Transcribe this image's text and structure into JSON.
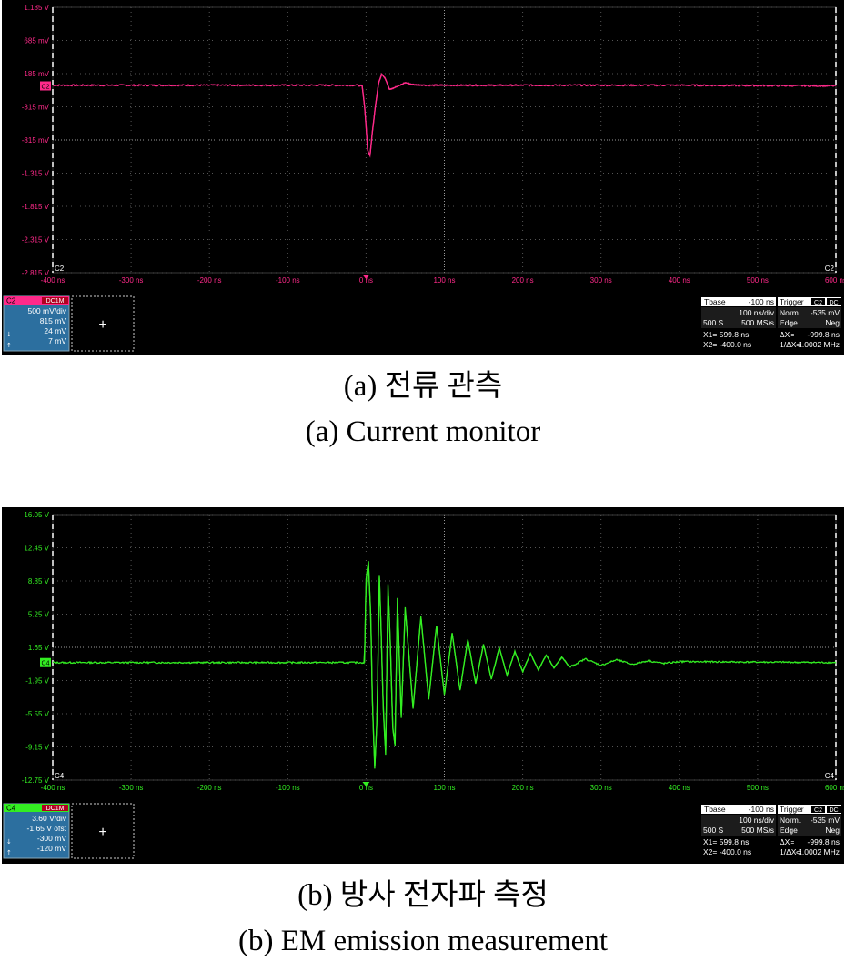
{
  "chart_data": [
    {
      "type": "line",
      "channel": "C2",
      "color": "#ff2a8a",
      "x_unit": "ns",
      "xlim": [
        -400,
        600
      ],
      "ylim": [
        -2.815,
        1.185
      ],
      "y_ticks": [
        "1.185 V",
        "685 mV",
        "185 mV",
        "-315 mV",
        "-815 mV",
        "-1.315 V",
        "-1.815 V",
        "-2.315 V",
        "-2.815 V"
      ],
      "x_ticks": [
        "-400 ns",
        "-300 ns",
        "-200 ns",
        "-100 ns",
        "0 ns",
        "100 ns",
        "200 ns",
        "300 ns",
        "400 ns",
        "500 ns",
        "600 ns"
      ],
      "ch_label": "C2",
      "grid": true,
      "series": [
        {
          "x": [
            -400,
            -200,
            -10,
            -5,
            -2,
            0,
            2,
            5,
            8,
            12,
            16,
            20,
            25,
            30,
            40,
            50,
            60,
            80,
            100,
            200,
            400,
            600
          ],
          "y": [
            0.01,
            0.01,
            0.01,
            0.0,
            -0.3,
            -0.6,
            -0.97,
            -1.05,
            -0.7,
            -0.3,
            0.05,
            0.18,
            0.1,
            -0.05,
            -0.01,
            0.05,
            0.02,
            0.01,
            0.01,
            0.01,
            0.01,
            0.0
          ]
        }
      ],
      "ch_panel": {
        "name": "C2",
        "coupling": "DC1M",
        "lines": [
          "500 mV/div",
          "815 mV",
          "24 mV",
          "7 mV"
        ]
      },
      "cursor_add": "+",
      "timebase": {
        "tbase_label": "Tbase",
        "tbase_value": "-100 ns",
        "trigger_label": "Trigger",
        "trigger_ch": "C2",
        "trigger_coupling": "DC",
        "div": "100 ns/div",
        "norm_label": "Norm.",
        "norm_value": "-535 mV",
        "samples": "500 S",
        "rate": "500 MS/s",
        "edge_label": "Edge",
        "edge_value": "Neg",
        "x1": "X1=   599.8 ns",
        "dx": "ΔX=",
        "dx_val": "-999.8 ns",
        "x2": "X2=  -400.0 ns",
        "inv_dx": "1/ΔX=",
        "inv_dx_val": "-1.0002 MHz"
      },
      "caption_ko": "(a)  전류  관측",
      "caption_en": "(a)  Current  monitor"
    },
    {
      "type": "line",
      "channel": "C4",
      "color": "#33ee22",
      "x_unit": "ns",
      "xlim": [
        -400,
        600
      ],
      "ylim": [
        -12.75,
        16.05
      ],
      "y_ticks": [
        "16.05 V",
        "12.45 V",
        "8.85 V",
        "5.25 V",
        "1.65 V",
        "-1.95 V",
        "-5.55 V",
        "-9.15 V",
        "-12.75 V"
      ],
      "x_ticks": [
        "-400 ns",
        "-300 ns",
        "-200 ns",
        "-100 ns",
        "0 ns",
        "100 ns",
        "200 ns",
        "300 ns",
        "400 ns",
        "500 ns",
        "600 ns"
      ],
      "ch_label": "C4",
      "grid": true,
      "series": [
        {
          "x": [
            -400,
            -100,
            -2,
            0,
            3,
            6,
            8,
            11,
            14,
            17,
            19,
            22,
            25,
            28,
            31,
            34,
            37,
            40,
            45,
            50,
            60,
            70,
            80,
            90,
            100,
            110,
            120,
            130,
            140,
            150,
            160,
            170,
            180,
            190,
            200,
            210,
            220,
            230,
            240,
            250,
            260,
            280,
            300,
            320,
            340,
            360,
            380,
            400,
            600
          ],
          "y": [
            0.0,
            0.0,
            0.0,
            9.0,
            11.0,
            5.0,
            -4.0,
            -11.5,
            -6.0,
            9.5,
            4.0,
            -5.0,
            -10.0,
            8.5,
            2.0,
            -7.0,
            -9.0,
            7.0,
            -6.0,
            6.0,
            -5.0,
            5.0,
            -4.0,
            4.0,
            -3.5,
            3.2,
            -3.0,
            2.5,
            -2.3,
            2.0,
            -1.8,
            1.6,
            -1.4,
            1.2,
            -1.0,
            1.0,
            -0.8,
            0.8,
            -0.6,
            0.6,
            -0.5,
            0.4,
            -0.3,
            0.3,
            -0.2,
            0.2,
            -0.1,
            0.1,
            0.0
          ]
        }
      ],
      "ch_panel": {
        "name": "C4",
        "coupling": "DC1M",
        "lines": [
          "3.60 V/div",
          "-1.65 V ofst",
          "-300 mV",
          "-120 mV"
        ]
      },
      "cursor_add": "+",
      "timebase": {
        "tbase_label": "Tbase",
        "tbase_value": "-100 ns",
        "trigger_label": "Trigger",
        "trigger_ch": "C2",
        "trigger_coupling": "DC",
        "div": "100 ns/div",
        "norm_label": "Norm.",
        "norm_value": "-535 mV",
        "samples": "500 S",
        "rate": "500 MS/s",
        "edge_label": "Edge",
        "edge_value": "Neg",
        "x1": "X1=   599.8 ns",
        "dx": "ΔX=",
        "dx_val": "-999.8 ns",
        "x2": "X2=  -400.0 ns",
        "inv_dx": "1/ΔX=",
        "inv_dx_val": "-1.0002 MHz"
      },
      "caption_ko": "(b)  방사  전자파  측정",
      "caption_en": "(b)  EM  emission  measurement"
    }
  ]
}
